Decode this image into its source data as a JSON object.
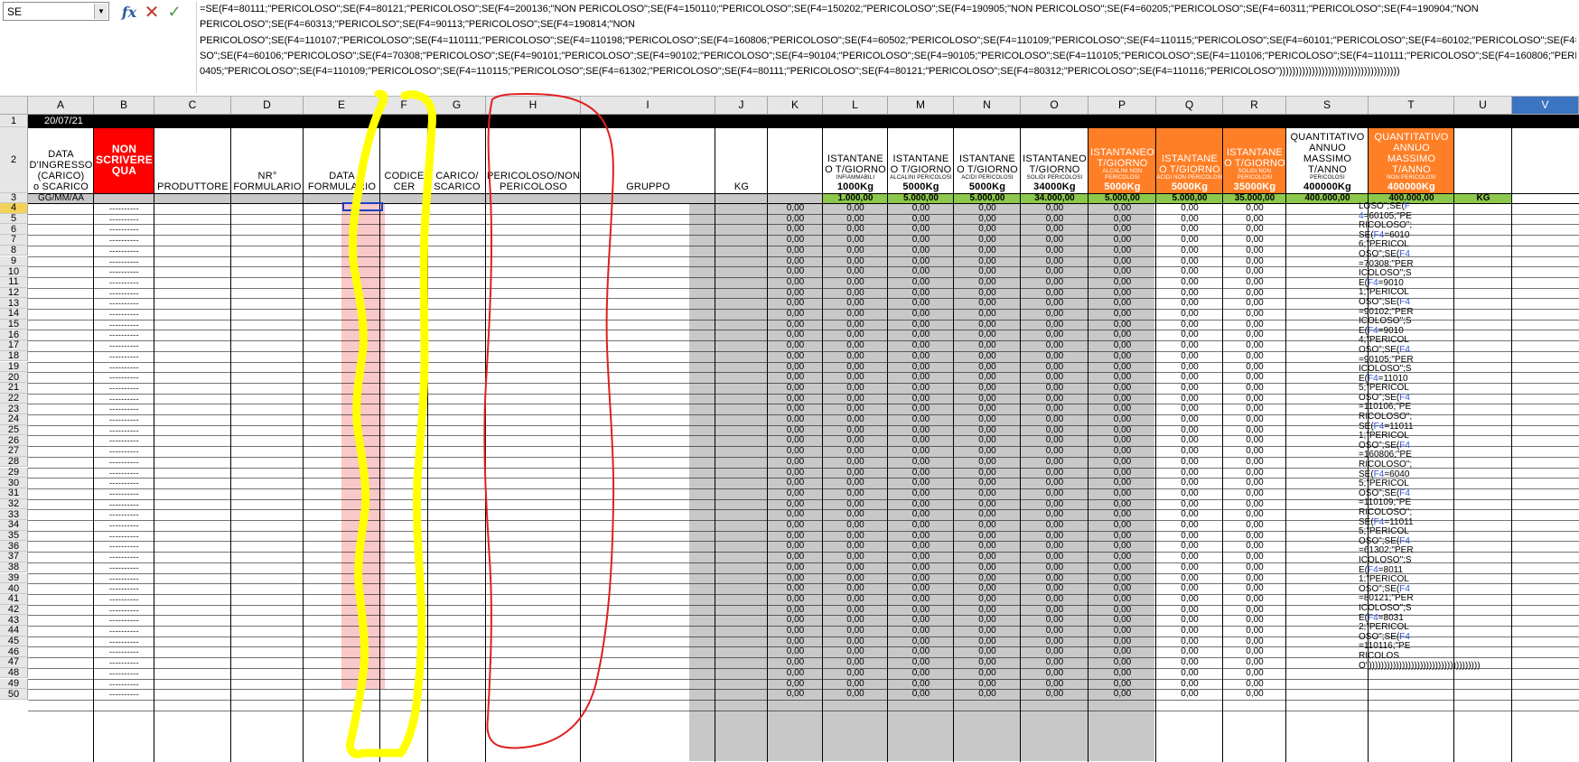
{
  "formula_bar": {
    "name_box": "SE",
    "icons": {
      "dropdown": "chevron-down-icon",
      "function_wizard": "fx-icon",
      "cancel": "close-icon",
      "accept": "check-icon"
    },
    "formula_lines": [
      "=SE(F4=80111;\"PERICOLOSO\";SE(F4=80121;\"PERICOLOSO\";SE(F4=200136;\"NON PERICOLOSO\";SE(F4=150110;\"PERICOLOSO\";SE(F4=150202;\"PERICOLOSO\";SE(F4=190905;\"NON PERICOLOSO\";SE(F4=60205;\"PERICOLOSO\";SE(F4=60311;\"PERICOLOSO\";SE(F4=190904;\"NON",
      "PERICOLOSO\";SE(F4=60313;\"PERICOLSO\";SE(F4=90113;\"PERICOLOSO\";SE(F4=190814;\"NON",
      "PERICOLOSO\";SE(F4=110107;\"PERICOLOSO\";SE(F4=110111;\"PERICOLOSO\";SE(F4=110198;\"PERICOLOSO\";SE(F4=160806;\"PERICOLOSO\";SE(F4=60502;\"PERICOLOSO\";SE(F4=110109;\"PERICOLOSO\";SE(F4=110115;\"PERICOLOSO\";SE(F4=60101;\"PERICOLOSO\";SE(F4=60102;\"PERICOLOSO\";SE(F4=6010",
      "SO\";SE(F4=60106;\"PERICOLOSO\";SE(F4=70308;\"PERICOLOSO\";SE(F4=90101;\"PERICOLOSO\";SE(F4=90102;\"PERICOLOSO\";SE(F4=90104;\"PERICOLOSO\";SE(F4=90105;\"PERICOLOSO\";SE(F4=110105;\"PERICOLOSO\";SE(F4=110106;\"PERICOLOSO\";SE(F4=110111;\"PERICOLOSO\";SE(F4=160806;\"PERICOLO",
      "0405;\"PERICOLOSO\";SE(F4=110109;\"PERICOLOSO\";SE(F4=110115;\"PERICOLOSO\";SE(F4=61302;\"PERICOLOSO\";SE(F4=80111;\"PERICOLOSO\";SE(F4=80121;\"PERICOLOSO\";SE(F4=80312;\"PERICOLOSO\";SE(F4=110116;\"PERICOLOSO\")))))))))))))))))))))))))))))))))))))"
    ]
  },
  "columns": [
    "A",
    "B",
    "C",
    "D",
    "E",
    "F",
    "G",
    "H",
    "I",
    "J",
    "K",
    "L",
    "M",
    "N",
    "O",
    "P",
    "Q",
    "R",
    "S",
    "T",
    "U",
    "V"
  ],
  "active_column": "V",
  "active_row": "4",
  "row1": {
    "date": "20/07/21"
  },
  "headers": {
    "A": [
      "DATA",
      "D'INGRESSO",
      "(CARICO)",
      "o SCARICO"
    ],
    "B": [
      "NON",
      "SCRIVERE",
      "QUA"
    ],
    "C": [
      "PRODUTTORE"
    ],
    "D": [
      "NR°",
      "FORMULARIO"
    ],
    "E": [
      "DATA",
      "FORMULARIO"
    ],
    "F": [
      "CODICE",
      "CER"
    ],
    "G": [
      "CARICO/",
      "SCARICO"
    ],
    "H": [
      "PERICOLOSO/NON",
      "PERICOLOSO"
    ],
    "I": [
      "GRUPPO"
    ],
    "J": [
      "KG"
    ],
    "L": {
      "lines": [
        "ISTANTANE",
        "O T/GIORNO"
      ],
      "sub": "INFIAMMABILI",
      "limit": "1000Kg"
    },
    "M": {
      "lines": [
        "ISTANTANE",
        "O T/GIORNO"
      ],
      "sub": "ALCALINI PERICOLOSI",
      "limit": "5000Kg"
    },
    "N": {
      "lines": [
        "ISTANTANE",
        "O T/GIORNO"
      ],
      "sub": "ACIDI PERICOLOSI",
      "limit": "5000Kg"
    },
    "O": {
      "lines": [
        "ISTANTANEO",
        "T/GIORNO"
      ],
      "sub": "SOLIDI PERICOLOSI",
      "limit": "34000Kg"
    },
    "P": {
      "lines": [
        "ISTANTANEO",
        "T/GIORNO"
      ],
      "sub": "ALCALINI NON PERICOLOSI",
      "limit": "5000Kg"
    },
    "Q": {
      "lines": [
        "ISTANTANE",
        "O T/GIORNO"
      ],
      "sub": "ACIDI NON PERICOLOSI",
      "limit": "5000Kg"
    },
    "R": {
      "lines": [
        "ISTANTANE",
        "O T/GIORNO"
      ],
      "sub": "SOLIDI NON PERICOLOSI",
      "limit": "35000Kg"
    },
    "S": {
      "lines": [
        "QUANTITATIVO",
        "ANNUO",
        "MASSIMO",
        "T/ANNO"
      ],
      "sub": "PERICOLOSI",
      "limit": "400000Kg"
    },
    "T": {
      "lines": [
        "QUANTITATIVO",
        "ANNUO MASSIMO",
        "T/ANNO"
      ],
      "sub": "NON PERICOLOSI",
      "limit": "400000Kg"
    }
  },
  "row3": {
    "A": "GG/MM/AA",
    "L": "1.000,00",
    "M": "5.000,00",
    "N": "5.000,00",
    "O": "34.000,00",
    "P": "5.000,00",
    "Q": "5.000,00",
    "R": "35.000,00",
    "S": "400.000,00",
    "T": "400.000,00",
    "U": "KG"
  },
  "data_rows": {
    "first_row": 4,
    "last_row": 50,
    "B_value": "----------",
    "numeric_value": "0,00",
    "numeric_columns": [
      "K",
      "L",
      "M",
      "N",
      "O",
      "P",
      "Q",
      "R"
    ]
  },
  "v_overflow_text": "LOSO\";SE(F4=60105;\"PERICOLOSO\";SE(F4=60106;\"PERICOLOSO\";SE(F4=70308;\"PERICOLOSO\";SE(F4=90101;\"PERICOLOSO\";SE(F4=90102;\"PERICOLOSO\";SE(F4=90104;\"PERICOLOSO\";SE(F4=90105;\"PERICOLOSO\";SE(F4=110105;\"PERICOLOSO\";SE(F4=110106;\"PERICOLOSO\";SE(F4=110111;\"PERICOLOSO\";SE(F4=160806;\"PERICOLOSO\";SE(F4=60405;\"PERICOLOSO\";SE(F4=110109;\"PERICOLOSO\";SE(F4=110115;\"PERICOLOSO\";SE(F4=61302;\"PERICOLOSO\";SE(F4=80111;\"PERICOLOSO\";SE(F4=80121;\"PERICOLOSO\";SE(F4=80312;\"PERICOLOSO\";SE(F4=110116;\"PERICOLOSO\")))))))))))))))))))))))))))))))))))))",
  "colors": {
    "red_header": "#ff0000",
    "orange_header": "#ff7f27",
    "green_limits": "#8cc84b",
    "grey_fill": "#c8c8c8",
    "pink_column": "#f9c8c8",
    "active_header": "#3b74c0",
    "yellow_markup": "#ffff00",
    "red_markup": "#e02020"
  }
}
